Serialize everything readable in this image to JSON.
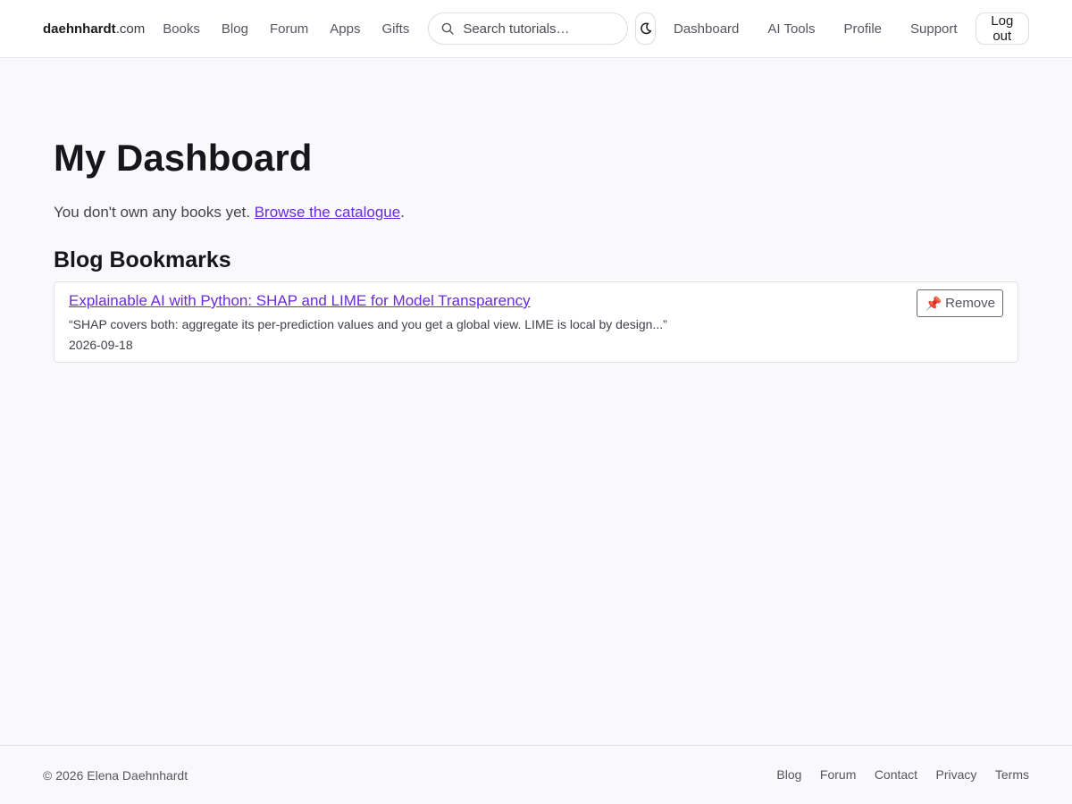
{
  "header": {
    "brand_bold": "daehnhardt",
    "brand_tld": ".com",
    "nav": [
      "Books",
      "Blog",
      "Forum",
      "Apps",
      "Gifts"
    ],
    "search_placeholder": "Search tutorials…",
    "theme_icon": "moon-icon",
    "right_nav": [
      "Dashboard",
      "AI Tools",
      "Profile",
      "Support"
    ],
    "logout_label": "Log out"
  },
  "main": {
    "title": "My Dashboard",
    "intro_text": "You don't own any books yet. ",
    "intro_link": "Browse the catalogue",
    "intro_end": ".",
    "bookmarks_heading": "Blog Bookmarks",
    "bookmarks": [
      {
        "title": "Explainable AI with Python: SHAP and LIME for Model Transparency",
        "quote": "“SHAP covers both: aggregate its per-prediction values and you get a global view. LIME is local by design...”",
        "date": "2026-09-18",
        "remove_label": "Remove",
        "remove_icon": "📌"
      }
    ]
  },
  "footer": {
    "copyright": "© 2026 Elena Daehnhardt",
    "links": [
      "Blog",
      "Forum",
      "Contact",
      "Privacy",
      "Terms"
    ]
  },
  "colors": {
    "accent_link": "#6a2bd9",
    "background": "#f9f9fb",
    "text": "#1a1a1f"
  }
}
